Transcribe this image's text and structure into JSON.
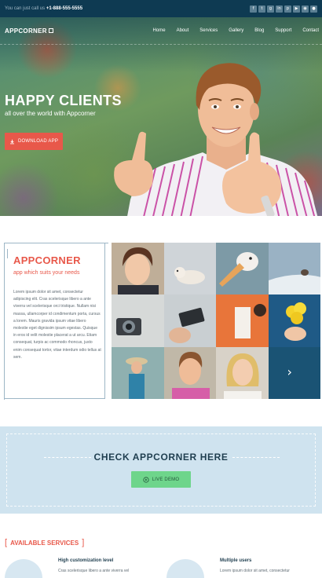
{
  "topbar": {
    "contact_prefix": "You can just call us",
    "phone": "+1-888-555-5555",
    "social_icons": [
      "facebook-icon",
      "twitter-icon",
      "google-plus-icon",
      "linkedin-icon",
      "pinterest-icon",
      "youtube-icon",
      "rss-icon",
      "dribbble-icon"
    ]
  },
  "nav": {
    "logo": "APPCORNER",
    "links": [
      "Home",
      "About",
      "Services",
      "Gallery",
      "Blog",
      "Support",
      "Contact"
    ]
  },
  "hero": {
    "title": "HAPPY CLIENTS",
    "subtitle": "all over the world with Appcorner",
    "button": "DOWNLOAD APP"
  },
  "about": {
    "title": "APPCORNER",
    "tagline": "app which suits your needs",
    "body": "Lorem ipsum dolor sit amet, consectetur adipiscing elit. Cras scelerisque libero a ante viverra vel scelerisque orci tristique. Nullam nisi massa, ullamcorper id condimentum porta, cursus a lorem. Mauris gravida ipsum vitae libero molestie eget dignissim ipsum egestas. Quisque in eros id velit molestie placerat a ut arcu. Etiam consequat, turpis ac commodo rhoncus, justo enim consequat tortor, vitae interdum odio tellus at sem."
  },
  "gallery": {
    "next_arrow": "›"
  },
  "check": {
    "title": "CHECK APPCORNER HERE",
    "button": "LIVE DEMO"
  },
  "services": {
    "heading": "AVAILABLE SERVICES",
    "items": [
      {
        "title": "High customization level",
        "desc": "Cras scelerisque libero a ante viverra vel"
      },
      {
        "title": "Multiple users",
        "desc": "Lorem ipsum dolor sit amet, consectetur"
      }
    ]
  },
  "colors": {
    "accent": "#e8584a",
    "topbar": "#0e3a52",
    "demo_button": "#6ed58b",
    "check_bg": "#cfe3ef"
  }
}
